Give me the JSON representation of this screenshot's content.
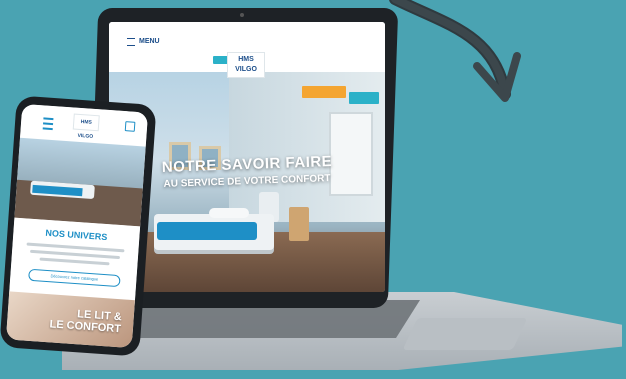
{
  "laptop_site": {
    "menu_label": "MENU",
    "logo_text": "HMS VILGO",
    "hero_title": "NOTRE SAVOIR FAIRE",
    "hero_subtitle": "AU SERVICE DE VOTRE CONFORT"
  },
  "phone_site": {
    "logo_text": "HMS VILGO",
    "section_title": "NOS UNIVERS",
    "cta_label": "Découvrez notre catalogue",
    "photo_text_line1": "LE LIT &",
    "photo_text_line2": "LE CONFORT"
  },
  "colors": {
    "background": "#4aa3b2",
    "brand_blue": "#1e8fc6",
    "accent_orange": "#f4a531"
  }
}
